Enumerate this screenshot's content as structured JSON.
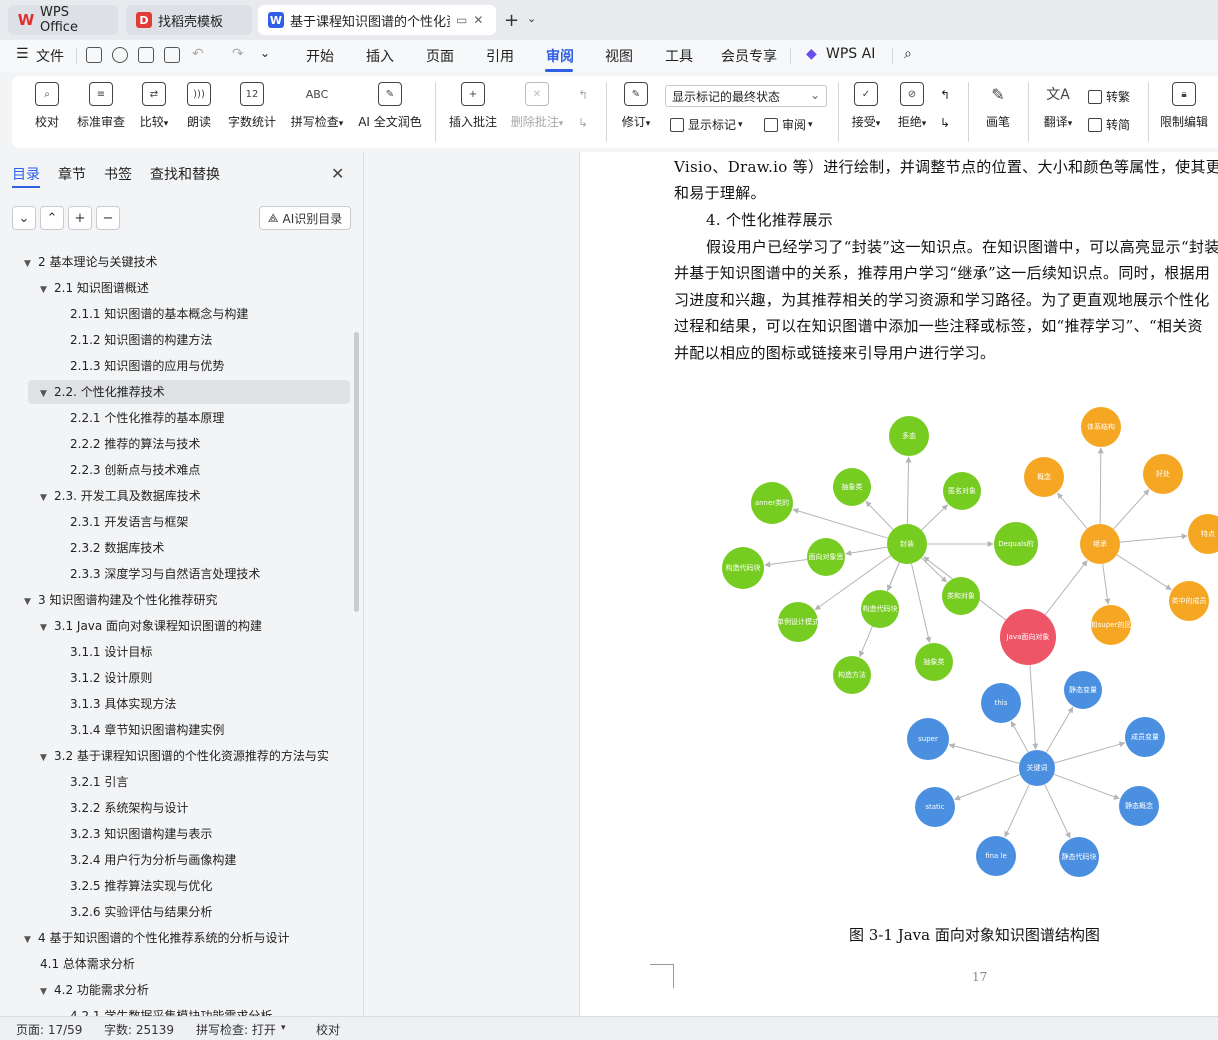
{
  "tabs": [
    {
      "label": "WPS Office"
    },
    {
      "label": "找稻壳模板"
    },
    {
      "label": "基于课程知识图谱的个性化资"
    }
  ],
  "menu": {
    "file": "文件",
    "items": [
      "开始",
      "插入",
      "页面",
      "引用",
      "审阅",
      "视图",
      "工具",
      "会员专享"
    ],
    "ai": "WPS AI",
    "active": "审阅"
  },
  "ribbon": {
    "proof": "校对",
    "std_review": "标准审查",
    "compare": "比较",
    "read": "朗读",
    "wordcount": "字数统计",
    "spellcheck": "拼写检查",
    "ai_polish": "AI 全文润色",
    "insert_comment": "插入批注",
    "delete_comment": "删除批注",
    "track": "修订",
    "markup_state": "显示标记的最终状态",
    "show_markup": "显示标记",
    "review": "审阅",
    "accept": "接受",
    "reject": "拒绝",
    "pen": "画笔",
    "translate": "翻译",
    "to_trad": "转繁",
    "to_simp": "转简",
    "restrict": "限制编辑"
  },
  "nav": {
    "tabs": [
      "目录",
      "章节",
      "书签",
      "查找和替换"
    ],
    "ai_toc": "AI识别目录"
  },
  "toc": [
    {
      "level": 1,
      "text": "2  基本理论与关键技术",
      "arrow": true
    },
    {
      "level": 2,
      "text": "2.1  知识图谱概述",
      "arrow": true
    },
    {
      "level": 3,
      "text": "2.1.1  知识图谱的基本概念与构建"
    },
    {
      "level": 3,
      "text": "2.1.2  知识图谱的构建方法"
    },
    {
      "level": 3,
      "text": "2.1.3  知识图谱的应用与优势"
    },
    {
      "level": 2,
      "text": "2.2. 个性化推荐技术",
      "arrow": true,
      "selected": true
    },
    {
      "level": 3,
      "text": "2.2.1  个性化推荐的基本原理"
    },
    {
      "level": 3,
      "text": "2.2.2  推荐的算法与技术"
    },
    {
      "level": 3,
      "text": "2.2.3  创新点与技术难点"
    },
    {
      "level": 2,
      "text": "2.3.  开发工具及数据库技术",
      "arrow": true
    },
    {
      "level": 3,
      "text": "2.3.1  开发语言与框架"
    },
    {
      "level": 3,
      "text": "2.3.2  数据库技术"
    },
    {
      "level": 3,
      "text": "2.3.3  深度学习与自然语言处理技术"
    },
    {
      "level": 1,
      "text": "3  知识图谱构建及个性化推荐研究",
      "arrow": true
    },
    {
      "level": 2,
      "text": "3.1 Java 面向对象课程知识图谱的构建",
      "arrow": true
    },
    {
      "level": 3,
      "text": "3.1.1  设计目标"
    },
    {
      "level": 3,
      "text": "3.1.2  设计原则"
    },
    {
      "level": 3,
      "text": "3.1.3  具体实现方法"
    },
    {
      "level": 3,
      "text": "3.1.4  章节知识图谱构建实例"
    },
    {
      "level": 2,
      "text": "3.2  基于课程知识图谱的个性化资源推荐的方法与实 ...",
      "arrow": true
    },
    {
      "level": 3,
      "text": "3.2.1  引言"
    },
    {
      "level": 3,
      "text": "3.2.2  系统架构与设计"
    },
    {
      "level": 3,
      "text": "3.2.3  知识图谱构建与表示"
    },
    {
      "level": 3,
      "text": "3.2.4  用户行为分析与画像构建"
    },
    {
      "level": 3,
      "text": "3.2.5  推荐算法实现与优化"
    },
    {
      "level": 3,
      "text": "3.2.6  实验评估与结果分析"
    },
    {
      "level": 1,
      "text": "4  基于知识图谱的个性化推荐系统的分析与设计",
      "arrow": true
    },
    {
      "level": 2,
      "text": "4.1  总体需求分析"
    },
    {
      "level": 2,
      "text": "4.2  功能需求分析",
      "arrow": true
    },
    {
      "level": 3,
      "text": "4.2.1  学生数据采集模块功能需求分析"
    }
  ],
  "doc": {
    "lines": [
      "Visio、Draw.io 等）进行绘制，并调整节点的位置、大小和颜色等属性，使其更",
      "和易于理解。",
      "4. 个性化推荐展示",
      "假设用户已经学习了“封装”这一知识点。在知识图谱中，可以高亮显示“封装",
      "并基于知识图谱中的关系，推荐用户学习“继承”这一后续知识点。同时，根据用",
      "习进度和兴趣，为其推荐相关的学习资源和学习路径。为了更直观地展示个性化",
      "过程和结果，可以在知识图谱中添加一些注释或标签，如“推荐学习”、“相关资",
      "并配以相应的图标或链接来引导用户进行学习。"
    ],
    "caption": "图 3-1 Java 面向对象知识图谱结构图",
    "page_number": "17"
  },
  "graph": {
    "colors": {
      "green": "#77cc22",
      "orange": "#f5a623",
      "blue": "#4a8fe0",
      "center": "#ee5566",
      "edge": "#b5b5b5"
    },
    "nodes": [
      {
        "id": "center",
        "label": "Java面向对象",
        "group": "center"
      },
      {
        "id": "fz",
        "label": "封装",
        "group": "green"
      },
      {
        "id": "jc",
        "label": "继承",
        "group": "orange"
      },
      {
        "id": "gjc",
        "label": "关键词",
        "group": "blue"
      },
      {
        "id": "g1",
        "label": "多态",
        "group": "green"
      },
      {
        "id": "g2",
        "label": "抽象类",
        "group": "green"
      },
      {
        "id": "g3",
        "label": "匿名对象",
        "group": "green"
      },
      {
        "id": "g4",
        "label": "anner类的",
        "group": "green"
      },
      {
        "id": "g5",
        "label": "面向对象思",
        "group": "green"
      },
      {
        "id": "g6",
        "label": "Dequals的",
        "group": "green"
      },
      {
        "id": "g7",
        "label": "构造代码块",
        "group": "green"
      },
      {
        "id": "g8",
        "label": "类和对象",
        "group": "green"
      },
      {
        "id": "g9",
        "label": "单例设计模式",
        "group": "green"
      },
      {
        "id": "g10",
        "label": "构造代码块",
        "group": "green"
      },
      {
        "id": "g11",
        "label": "构造方法",
        "group": "green"
      },
      {
        "id": "g12",
        "label": "抽象类",
        "group": "green"
      },
      {
        "id": "o1",
        "label": "体系结构",
        "group": "orange"
      },
      {
        "id": "o2",
        "label": "概念",
        "group": "orange"
      },
      {
        "id": "o3",
        "label": "好处",
        "group": "orange"
      },
      {
        "id": "o4",
        "label": "特点",
        "group": "orange"
      },
      {
        "id": "o5",
        "label": "类中的成员",
        "group": "orange"
      },
      {
        "id": "o6",
        "label": "和super的区",
        "group": "orange"
      },
      {
        "id": "b1",
        "label": "this",
        "group": "blue"
      },
      {
        "id": "b2",
        "label": "静态变量",
        "group": "blue"
      },
      {
        "id": "b3",
        "label": "super",
        "group": "blue"
      },
      {
        "id": "b4",
        "label": "成员变量",
        "group": "blue"
      },
      {
        "id": "b5",
        "label": "static",
        "group": "blue"
      },
      {
        "id": "b6",
        "label": "静态概念",
        "group": "blue"
      },
      {
        "id": "b7",
        "label": "fina le",
        "group": "blue"
      },
      {
        "id": "b8",
        "label": "静态代码块",
        "group": "blue"
      }
    ]
  },
  "status": {
    "page": "页面: 17/59",
    "words": "字数: 25139",
    "spell": "拼写检查: 打开",
    "proof": "校对"
  }
}
